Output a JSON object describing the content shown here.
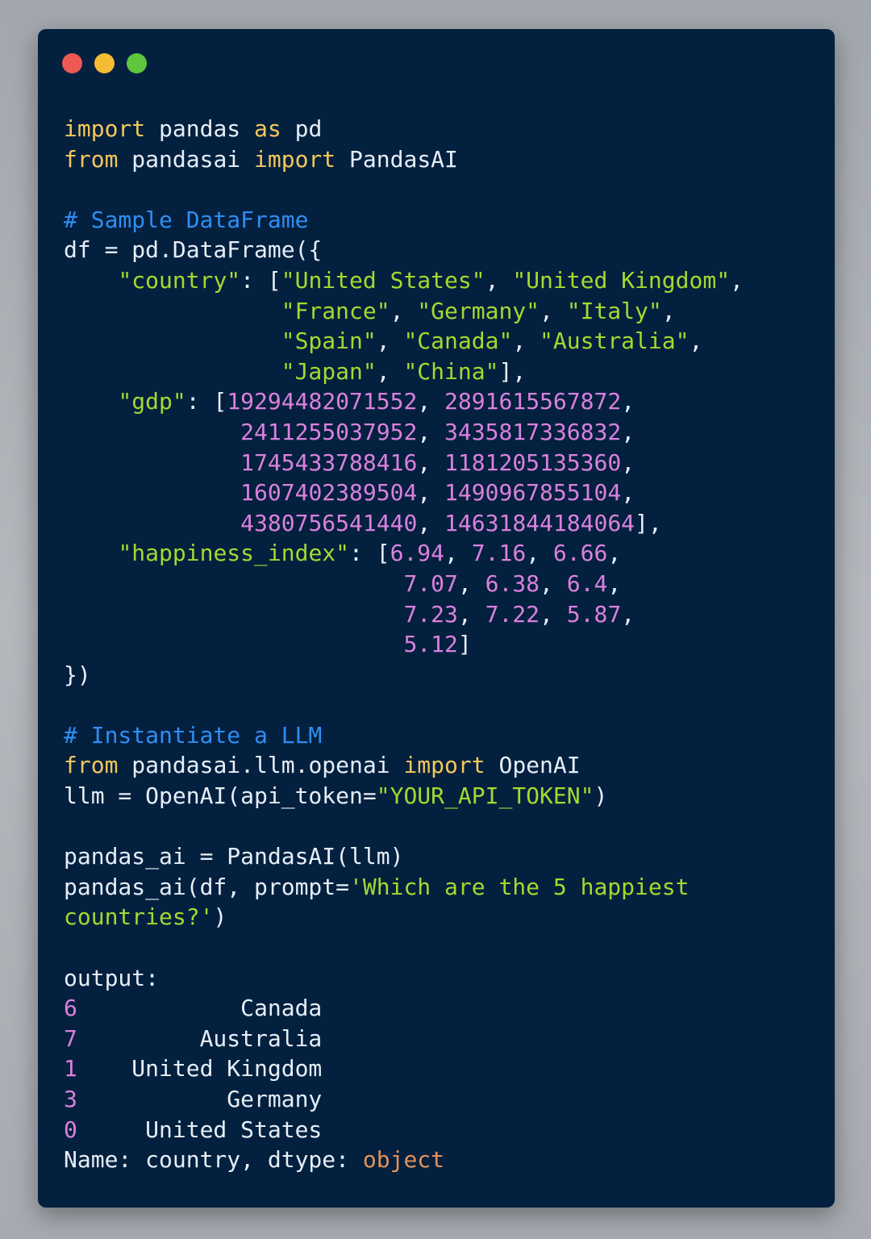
{
  "colors": {
    "window_bg": "#04203f",
    "dot_close": "#ee5a52",
    "dot_minimize": "#f5bd35",
    "dot_zoom": "#5fc63d",
    "text": "#e6eef6",
    "keyword": "#f4c85a",
    "comment": "#2f8ef3",
    "string": "#a4d92f",
    "number": "#da81dd",
    "type": "#e3925a"
  },
  "window_controls": [
    "close",
    "minimize",
    "zoom"
  ],
  "code_lines": [
    [
      {
        "t": "import",
        "c": "kw"
      },
      {
        "t": " pandas "
      },
      {
        "t": "as",
        "c": "kw"
      },
      {
        "t": " pd"
      }
    ],
    [
      {
        "t": "from",
        "c": "kw"
      },
      {
        "t": " pandasai "
      },
      {
        "t": "import",
        "c": "kw"
      },
      {
        "t": " PandasAI"
      }
    ],
    [],
    [
      {
        "t": "# Sample DataFrame",
        "c": "cm"
      }
    ],
    [
      {
        "t": "df = pd.DataFrame({"
      }
    ],
    [
      {
        "t": "    "
      },
      {
        "t": "\"country\"",
        "c": "str"
      },
      {
        "t": ": ["
      },
      {
        "t": "\"United States\"",
        "c": "str"
      },
      {
        "t": ", "
      },
      {
        "t": "\"United Kingdom\"",
        "c": "str"
      },
      {
        "t": ","
      }
    ],
    [
      {
        "t": "                "
      },
      {
        "t": "\"France\"",
        "c": "str"
      },
      {
        "t": ", "
      },
      {
        "t": "\"Germany\"",
        "c": "str"
      },
      {
        "t": ", "
      },
      {
        "t": "\"Italy\"",
        "c": "str"
      },
      {
        "t": ","
      }
    ],
    [
      {
        "t": "                "
      },
      {
        "t": "\"Spain\"",
        "c": "str"
      },
      {
        "t": ", "
      },
      {
        "t": "\"Canada\"",
        "c": "str"
      },
      {
        "t": ", "
      },
      {
        "t": "\"Australia\"",
        "c": "str"
      },
      {
        "t": ","
      }
    ],
    [
      {
        "t": "                "
      },
      {
        "t": "\"Japan\"",
        "c": "str"
      },
      {
        "t": ", "
      },
      {
        "t": "\"China\"",
        "c": "str"
      },
      {
        "t": "],"
      }
    ],
    [
      {
        "t": "    "
      },
      {
        "t": "\"gdp\"",
        "c": "str"
      },
      {
        "t": ": ["
      },
      {
        "t": "19294482071552",
        "c": "num"
      },
      {
        "t": ", "
      },
      {
        "t": "2891615567872",
        "c": "num"
      },
      {
        "t": ","
      }
    ],
    [
      {
        "t": "             "
      },
      {
        "t": "2411255037952",
        "c": "num"
      },
      {
        "t": ", "
      },
      {
        "t": "3435817336832",
        "c": "num"
      },
      {
        "t": ","
      }
    ],
    [
      {
        "t": "             "
      },
      {
        "t": "1745433788416",
        "c": "num"
      },
      {
        "t": ", "
      },
      {
        "t": "1181205135360",
        "c": "num"
      },
      {
        "t": ","
      }
    ],
    [
      {
        "t": "             "
      },
      {
        "t": "1607402389504",
        "c": "num"
      },
      {
        "t": ", "
      },
      {
        "t": "1490967855104",
        "c": "num"
      },
      {
        "t": ","
      }
    ],
    [
      {
        "t": "             "
      },
      {
        "t": "4380756541440",
        "c": "num"
      },
      {
        "t": ", "
      },
      {
        "t": "14631844184064",
        "c": "num"
      },
      {
        "t": "],"
      }
    ],
    [
      {
        "t": "    "
      },
      {
        "t": "\"happiness_index\"",
        "c": "str"
      },
      {
        "t": ": ["
      },
      {
        "t": "6.94",
        "c": "num"
      },
      {
        "t": ", "
      },
      {
        "t": "7.16",
        "c": "num"
      },
      {
        "t": ", "
      },
      {
        "t": "6.66",
        "c": "num"
      },
      {
        "t": ","
      }
    ],
    [
      {
        "t": "                         "
      },
      {
        "t": "7.07",
        "c": "num"
      },
      {
        "t": ", "
      },
      {
        "t": "6.38",
        "c": "num"
      },
      {
        "t": ", "
      },
      {
        "t": "6.4",
        "c": "num"
      },
      {
        "t": ","
      }
    ],
    [
      {
        "t": "                         "
      },
      {
        "t": "7.23",
        "c": "num"
      },
      {
        "t": ", "
      },
      {
        "t": "7.22",
        "c": "num"
      },
      {
        "t": ", "
      },
      {
        "t": "5.87",
        "c": "num"
      },
      {
        "t": ","
      }
    ],
    [
      {
        "t": "                         "
      },
      {
        "t": "5.12",
        "c": "num"
      },
      {
        "t": "]"
      }
    ],
    [
      {
        "t": "})"
      }
    ],
    [],
    [
      {
        "t": "# Instantiate a LLM",
        "c": "cm"
      }
    ],
    [
      {
        "t": "from",
        "c": "kw"
      },
      {
        "t": " pandasai.llm.openai "
      },
      {
        "t": "import",
        "c": "kw"
      },
      {
        "t": " OpenAI"
      }
    ],
    [
      {
        "t": "llm = OpenAI(api_token="
      },
      {
        "t": "\"YOUR_API_TOKEN\"",
        "c": "str"
      },
      {
        "t": ")"
      }
    ],
    [],
    [
      {
        "t": "pandas_ai = PandasAI(llm)"
      }
    ],
    [
      {
        "t": "pandas_ai(df, prompt="
      },
      {
        "t": "'Which are the 5 happiest",
        "c": "str"
      }
    ],
    [
      {
        "t": "countries?'",
        "c": "str"
      },
      {
        "t": ")"
      }
    ],
    [],
    [
      {
        "t": "output:"
      }
    ],
    [
      {
        "t": "6",
        "c": "num"
      },
      {
        "t": "            Canada"
      }
    ],
    [
      {
        "t": "7",
        "c": "num"
      },
      {
        "t": "         Australia"
      }
    ],
    [
      {
        "t": "1",
        "c": "num"
      },
      {
        "t": "    United Kingdom"
      }
    ],
    [
      {
        "t": "3",
        "c": "num"
      },
      {
        "t": "           Germany"
      }
    ],
    [
      {
        "t": "0",
        "c": "num"
      },
      {
        "t": "     United States"
      }
    ],
    [
      {
        "t": "Name: country, dtype: "
      },
      {
        "t": "object",
        "c": "typ"
      }
    ]
  ]
}
